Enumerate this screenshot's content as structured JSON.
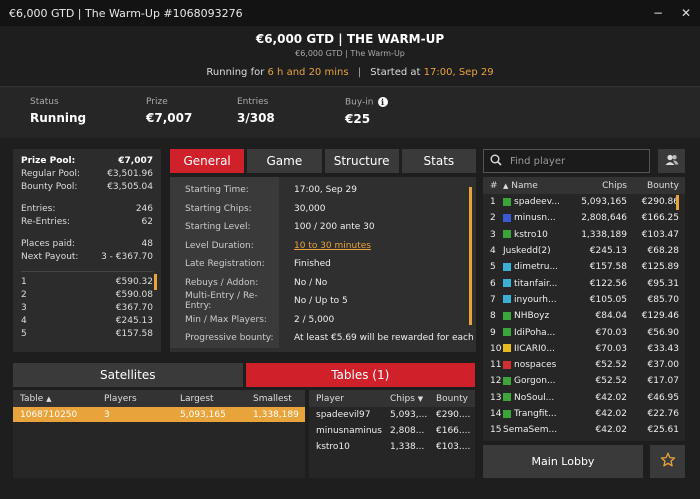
{
  "window": {
    "title": "€6,000 GTD  |  The Warm-Up #1068093276",
    "minimize": "−",
    "close": "✕"
  },
  "header": {
    "title": "€6,000 GTD  |  THE WARM-UP",
    "subtitle": "€6,000 GTD  |  The Warm-Up",
    "running_label": "Running for",
    "running_value": "6 h and 20 mins",
    "separator": "|",
    "started_label": "Started at",
    "started_value": "17:00, Sep 29"
  },
  "summary": {
    "status_label": "Status",
    "status_value": "Running",
    "prize_label": "Prize",
    "prize_value": "€7,007",
    "entries_label": "Entries",
    "entries_value": "3/308",
    "buyin_label": "Buy-in",
    "buyin_value": "€25",
    "buyin_info_icon": "i"
  },
  "prize": {
    "pool_label": "Prize Pool:",
    "pool_value": "€7,007",
    "regular_label": "Regular Pool:",
    "regular_value": "€3,501.96",
    "bounty_label": "Bounty Pool:",
    "bounty_value": "€3,505.04",
    "entries_label": "Entries:",
    "entries_value": "246",
    "reentries_label": "Re-Entries:",
    "reentries_value": "62",
    "places_label": "Places paid:",
    "places_value": "48",
    "next_label": "Next Payout:",
    "next_value": "3 - €367.70",
    "payouts": [
      {
        "place": "1",
        "amount": "€590.32"
      },
      {
        "place": "2",
        "amount": "€590.08"
      },
      {
        "place": "3",
        "amount": "€367.70"
      },
      {
        "place": "4",
        "amount": "€245.13"
      },
      {
        "place": "5",
        "amount": "€157.58"
      }
    ]
  },
  "tabs": [
    "General",
    "Game",
    "Structure",
    "Stats"
  ],
  "details": [
    {
      "k": "Starting Time:",
      "v": "17:00, Sep 29"
    },
    {
      "k": "Starting Chips:",
      "v": "30,000"
    },
    {
      "k": "Starting Level:",
      "v": "100 / 200 ante 30"
    },
    {
      "k": "Level Duration:",
      "v": "10 to 30 minutes"
    },
    {
      "k": "Late Registration:",
      "v": "Finished"
    },
    {
      "k": "Rebuys / Addon:",
      "v": "No / No"
    },
    {
      "k": "Multi-Entry / Re-Entry:",
      "v": "No / Up to 5"
    },
    {
      "k": "Min / Max Players:",
      "v": "2 / 5,000"
    },
    {
      "k": "Progressive bounty:",
      "v": "At least €5.69 will be rewarded for each"
    }
  ],
  "bottom_tabs": {
    "satellites": "Satellites",
    "tables": "Tables (1)"
  },
  "tables": {
    "headers": [
      "Table",
      "Players",
      "Largest",
      "Smallest"
    ],
    "sort_icon": "▲",
    "rows": [
      [
        "1068710250",
        "3",
        "5,093,165",
        "1,338,189"
      ]
    ]
  },
  "table_players": {
    "headers": [
      "Player",
      "Chips",
      "Bounty"
    ],
    "sort_icon": "▼",
    "rows": [
      [
        "spadeevil97",
        "5,093,...",
        "€290...."
      ],
      [
        "minusnaminus",
        "2,808...",
        "€166...."
      ],
      [
        "kstro10",
        "1,338...",
        "€103...."
      ]
    ]
  },
  "search": {
    "placeholder": "Find player",
    "icon": "search-icon"
  },
  "players": {
    "headers": [
      "#",
      "Name",
      "Chips",
      "Bounty"
    ],
    "sort_icon": "▲",
    "rows": [
      {
        "rank": "1",
        "color": "#3aa53a",
        "name": "spadeev...",
        "chips": "5,093,165",
        "bounty": "€290.86"
      },
      {
        "rank": "2",
        "color": "#3a5bd6",
        "name": "minusn...",
        "chips": "2,808,646",
        "bounty": "€166.25"
      },
      {
        "rank": "3",
        "color": "#3aa53a",
        "name": "kstro10",
        "chips": "1,338,189",
        "bounty": "€103.47"
      },
      {
        "rank": "4",
        "color": "",
        "name": "Juskedd(2)",
        "chips": "€245.13",
        "bounty": "€68.28"
      },
      {
        "rank": "5",
        "color": "#3ab0d6",
        "name": "dimetru...",
        "chips": "€157.58",
        "bounty": "€125.89"
      },
      {
        "rank": "6",
        "color": "#3ab0d6",
        "name": "titanfair...",
        "chips": "€122.56",
        "bounty": "€95.31"
      },
      {
        "rank": "7",
        "color": "#3ab0d6",
        "name": "inyourh...",
        "chips": "€105.05",
        "bounty": "€85.70"
      },
      {
        "rank": "8",
        "color": "#3aa53a",
        "name": "NHBoyz",
        "chips": "€84.04",
        "bounty": "€129.46"
      },
      {
        "rank": "9",
        "color": "#3aa53a",
        "name": "IdiPoha...",
        "chips": "€70.03",
        "bounty": "€56.90"
      },
      {
        "rank": "10",
        "color": "#e8b820",
        "name": "IICARI0...",
        "chips": "€70.03",
        "bounty": "€33.43"
      },
      {
        "rank": "11",
        "color": "#d03030",
        "name": "nospaces",
        "chips": "€52.52",
        "bounty": "€37.00"
      },
      {
        "rank": "12",
        "color": "#3aa53a",
        "name": "Gorgon...",
        "chips": "€52.52",
        "bounty": "€17.07"
      },
      {
        "rank": "13",
        "color": "#3aa53a",
        "name": "NoSoul...",
        "chips": "€42.02",
        "bounty": "€46.95"
      },
      {
        "rank": "14",
        "color": "#3aa53a",
        "name": "Trangfit...",
        "chips": "€42.02",
        "bounty": "€22.76"
      },
      {
        "rank": "15",
        "color": "",
        "name": "SemaSem...",
        "chips": "€42.02",
        "bounty": "€25.61"
      }
    ]
  },
  "main_lobby": "Main Lobby",
  "accent": {
    "red": "#d0212a",
    "orange": "#e8a33a"
  }
}
